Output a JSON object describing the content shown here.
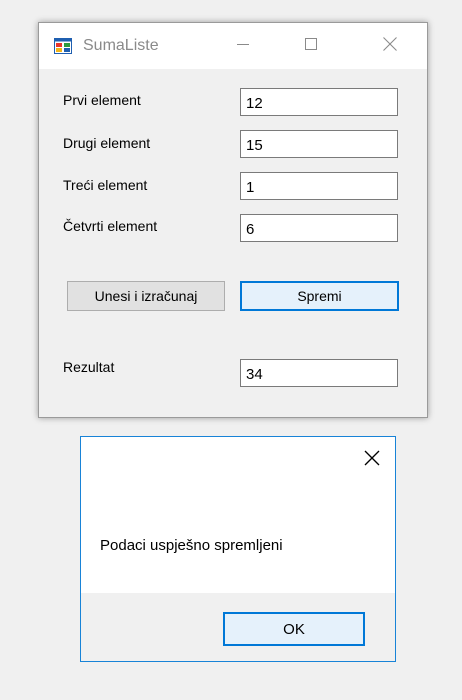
{
  "main_window": {
    "title": "SumaListe",
    "fields": [
      {
        "label": "Prvi element",
        "value": "12"
      },
      {
        "label": "Drugi element",
        "value": "15"
      },
      {
        "label": "Treći element",
        "value": "1"
      },
      {
        "label": "Četvrti element",
        "value": "6"
      }
    ],
    "buttons": {
      "compute_label": "Unesi i izračunaj",
      "save_label": "Spremi"
    },
    "result": {
      "label": "Rezultat",
      "value": "34"
    }
  },
  "message_box": {
    "text": "Podaci uspješno spremljeni",
    "ok_label": "OK"
  },
  "colors": {
    "accent": "#0078d7",
    "window_bg": "#f0f0f0",
    "titlebar_bg": "#ffffff"
  },
  "icons": [
    "app-form-icon",
    "minimize-icon",
    "maximize-icon",
    "close-icon"
  ]
}
